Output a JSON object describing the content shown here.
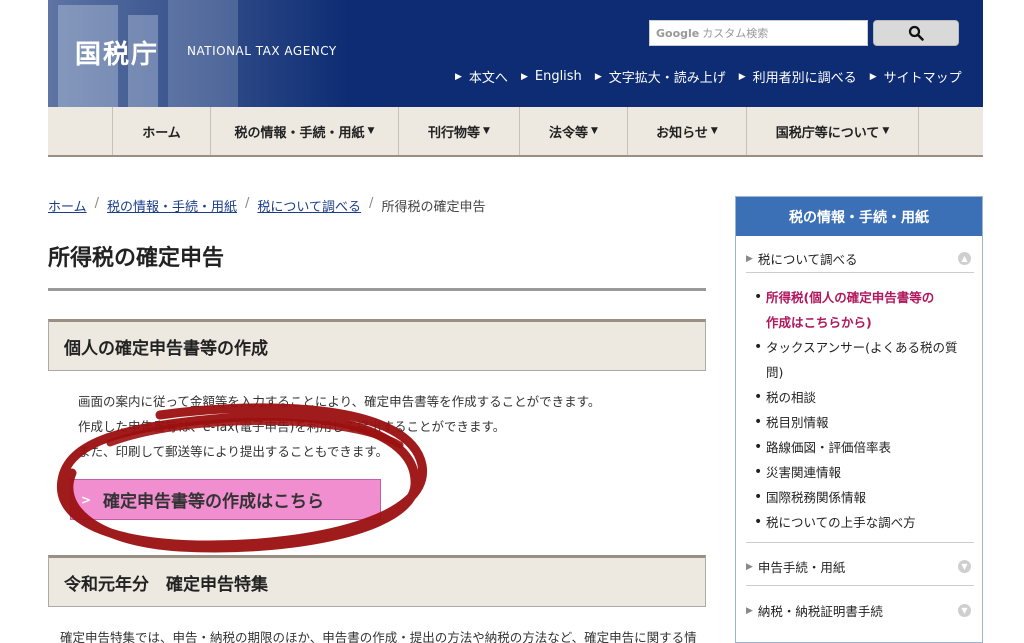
{
  "header": {
    "logo": "国税庁",
    "logo_en": "NATIONAL TAX AGENCY",
    "search_brand": "Google",
    "search_placeholder": "カスタム検索",
    "search_icon": "magnifier-icon",
    "util_links": [
      "本文へ",
      "English",
      "文字拡大・読み上げ",
      "利用者別に調べる",
      "サイトマップ"
    ]
  },
  "nav": {
    "items": [
      {
        "label": "ホーム",
        "dropdown": false
      },
      {
        "label": "税の情報・手続・用紙",
        "dropdown": true
      },
      {
        "label": "刊行物等",
        "dropdown": true
      },
      {
        "label": "法令等",
        "dropdown": true
      },
      {
        "label": "お知らせ",
        "dropdown": true
      },
      {
        "label": "国税庁等について",
        "dropdown": true
      }
    ]
  },
  "breadcrumb": {
    "links": [
      "ホーム",
      "税の情報・手続・用紙",
      "税について調べる"
    ],
    "current": "所得税の確定申告"
  },
  "page": {
    "title": "所得税の確定申告",
    "section1_title": "個人の確定申告書等の作成",
    "section1_lines": [
      "画面の案内に従って金額等を入力することにより、確定申告書等を作成することができます。",
      "作成した申告書等は、e-Tax(電子申告)を利用して提出することができます。",
      "また、印刷して郵送等により提出することもできます。"
    ],
    "cta_label": "確定申告書等の作成はこちら",
    "section2_title": "令和元年分　確定申告特集",
    "section2_text": "確定申告特集では、申告・納税の期限のほか、申告書の作成・提出の方法や納税の方法など、確定申告に関する情"
  },
  "sidebar": {
    "heading": "税の情報・手続・用紙",
    "category1": "税について調べる",
    "items": [
      {
        "lines": [
          "所得税(個人の確定申告書等の",
          "作成はこちらから)"
        ],
        "active": true
      },
      {
        "lines": [
          "タックスアンサー(よくある税の質",
          "問)"
        ],
        "active": false
      },
      {
        "lines": [
          "税の相談"
        ],
        "active": false
      },
      {
        "lines": [
          "税目別情報"
        ],
        "active": false
      },
      {
        "lines": [
          "路線価図・評価倍率表"
        ],
        "active": false
      },
      {
        "lines": [
          "災害関連情報"
        ],
        "active": false
      },
      {
        "lines": [
          "国際税務関係情報"
        ],
        "active": false
      },
      {
        "lines": [
          "税についての上手な調べ方"
        ],
        "active": false
      }
    ],
    "category2": "申告手続・用紙",
    "category3": "納税・納税証明書手続"
  },
  "colors": {
    "header_bg": "#0d2c73",
    "nav_bg": "#ede8e0",
    "cta_bg": "#f08ed0",
    "sidebar_head": "#3b6fb6",
    "active_link": "#b0175e",
    "annotation_circle": "#9b1010"
  }
}
